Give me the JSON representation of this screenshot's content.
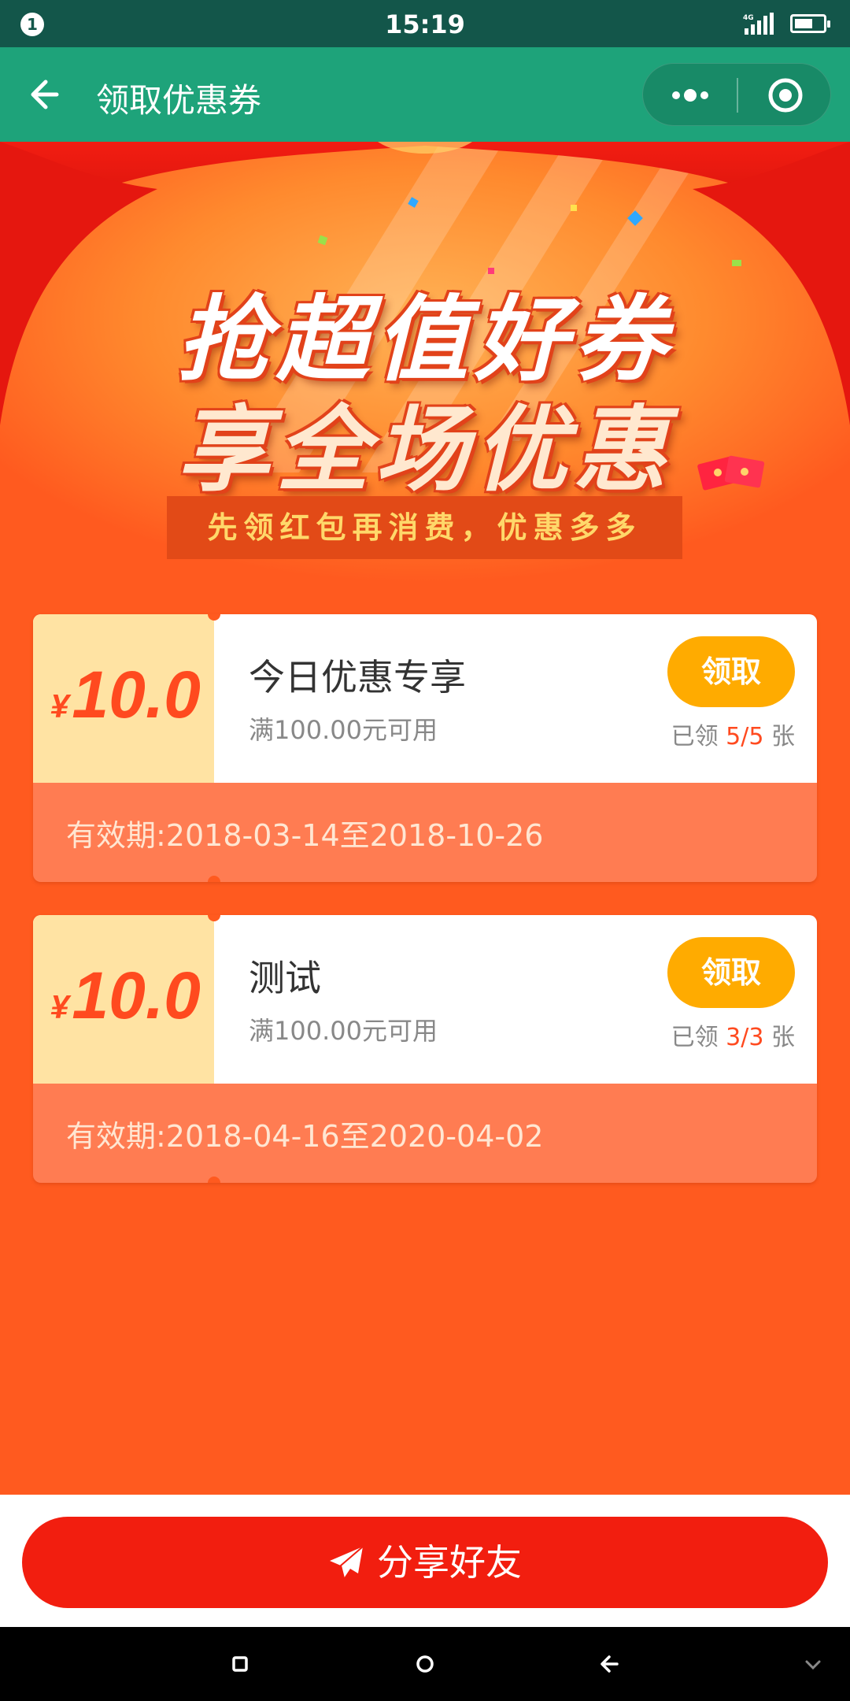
{
  "status_bar": {
    "notification_count": "1",
    "time": "15:19",
    "network": "4G",
    "battery_level": 0.55,
    "icons": [
      "notification-badge-icon",
      "signal-icon",
      "battery-icon"
    ]
  },
  "nav": {
    "title": "领取优惠券",
    "icons": [
      "back-arrow-icon",
      "more-dots-icon",
      "close-target-icon"
    ],
    "color": "#1ea37a"
  },
  "banner": {
    "headline_line1": "抢超值好券",
    "headline_line2": "享全场优惠",
    "subtitle": "先领红包再消费，优惠多多"
  },
  "coupons": [
    {
      "currency": "¥",
      "amount": "10.0",
      "name": "今日优惠专享",
      "condition": "满100.00元可用",
      "claim_label": "领取",
      "claimed_prefix": "已领",
      "claimed_count": "5/5",
      "claimed_suffix": "张",
      "validity": "有效期:2018-03-14至2018-10-26"
    },
    {
      "currency": "¥",
      "amount": "10.0",
      "name": "测试",
      "condition": "满100.00元可用",
      "claim_label": "领取",
      "claimed_prefix": "已领",
      "claimed_count": "3/3",
      "claimed_suffix": "张",
      "validity": "有效期:2018-04-16至2020-04-02"
    }
  ],
  "share": {
    "label": "分享好友",
    "icon": "paper-plane-icon"
  },
  "system_nav": {
    "icons": [
      "recents-square-icon",
      "home-circle-icon",
      "back-icon",
      "collapse-chevron-icon"
    ]
  },
  "colors": {
    "page_bg": "#ff5a1f",
    "coupon_amount": "#ff4a1f",
    "claim_button": "#ffab00",
    "share_button": "#f21e0f"
  }
}
